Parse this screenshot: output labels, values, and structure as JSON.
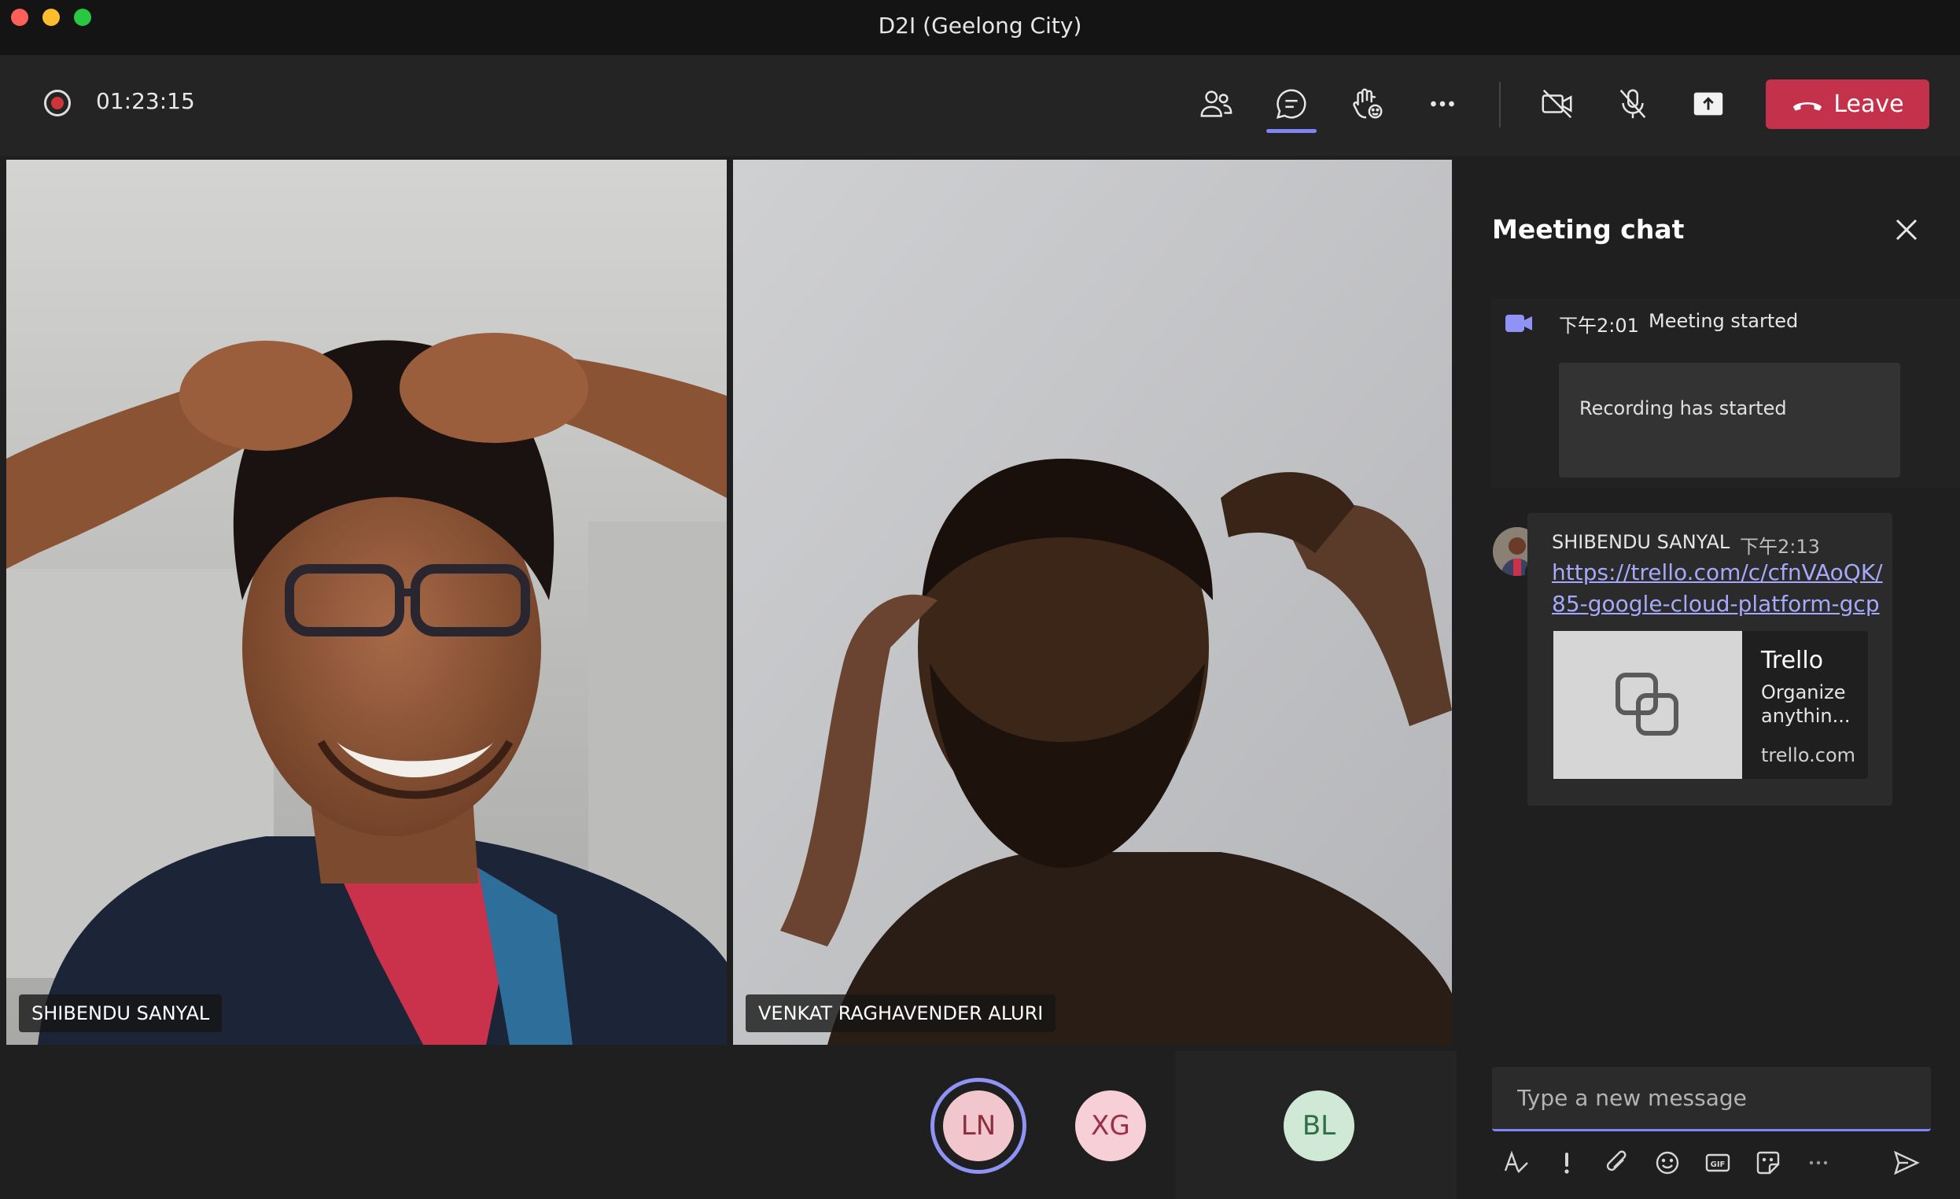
{
  "window": {
    "title": "D2I (Geelong City)"
  },
  "toolbar": {
    "timer": "01:23:15",
    "leave_label": "Leave",
    "icons": [
      "participants-icon",
      "chat-icon",
      "raise-hand-icon",
      "more-icon",
      "camera-off-icon",
      "mic-off-icon",
      "share-icon"
    ]
  },
  "videos": [
    {
      "name": "SHIBENDU SANYAL"
    },
    {
      "name": "VENKAT RAGHAVENDER ALURI"
    }
  ],
  "participants": [
    {
      "initials": "LN",
      "bg": "#f1c7cd",
      "fg": "#8e2f3e"
    },
    {
      "initials": "XG",
      "bg": "#f6cfd7",
      "fg": "#9a3045"
    },
    {
      "initials": "BL",
      "bg": "#cfe9d6",
      "fg": "#2f6f45"
    }
  ],
  "chat": {
    "title": "Meeting chat",
    "system_time": "下午2:01",
    "system_text": "Meeting started",
    "recording_text": "Recording has started",
    "message": {
      "sender": "SHIBENDU SANYAL",
      "time": "下午2:13",
      "link_line1": "https://trello.com/c/cfnVAoQK/",
      "link_line2": "85-google-cloud-platform-gcp",
      "preview_title": "Trello",
      "preview_desc_1": "Organize",
      "preview_desc_2": "anythin...",
      "preview_domain": "trello.com"
    },
    "input_placeholder": "Type a new message"
  },
  "colors": {
    "accent": "#7f85f5",
    "leave": "#c4314b",
    "recording": "#d13438"
  }
}
